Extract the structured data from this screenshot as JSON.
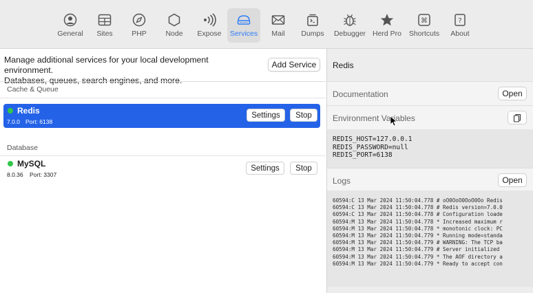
{
  "toolbar": {
    "items": [
      {
        "label": "General",
        "icon": "general-icon"
      },
      {
        "label": "Sites",
        "icon": "sites-icon"
      },
      {
        "label": "PHP",
        "icon": "php-icon"
      },
      {
        "label": "Node",
        "icon": "node-icon"
      },
      {
        "label": "Expose",
        "icon": "expose-icon"
      },
      {
        "label": "Services",
        "icon": "services-icon"
      },
      {
        "label": "Mail",
        "icon": "mail-icon"
      },
      {
        "label": "Dumps",
        "icon": "dumps-icon"
      },
      {
        "label": "Debugger",
        "icon": "debugger-icon"
      },
      {
        "label": "Herd Pro",
        "icon": "star-icon"
      },
      {
        "label": "Shortcuts",
        "icon": "command-icon"
      },
      {
        "label": "About",
        "icon": "question-icon"
      }
    ],
    "active": "Services",
    "accent": "#2e7cf6"
  },
  "left": {
    "intro_line1": "Manage additional services for your local development environment.",
    "intro_line2": "Databases, queues, search engines, and more.",
    "add_service_label": "Add Service",
    "sections": [
      {
        "title": "Cache & Queue",
        "services": [
          {
            "name": "Redis",
            "version": "7.0.0",
            "port": "Port: 6138",
            "status_color": "#31c748",
            "settings_label": "Settings",
            "stop_label": "Stop",
            "selected": true
          }
        ]
      },
      {
        "title": "Database",
        "services": [
          {
            "name": "MySQL",
            "version": "8.0.36",
            "port": "Port: 3307",
            "status_color": "#31c748",
            "settings_label": "Settings",
            "stop_label": "Stop",
            "selected": false
          }
        ]
      }
    ],
    "selection_color": "#2463e8"
  },
  "right": {
    "title": "Redis",
    "documentation_label": "Documentation",
    "documentation_button": "Open",
    "env_label": "Environment Variables",
    "env_vars": [
      "REDIS_HOST=127.0.0.1",
      "REDIS_PASSWORD=null",
      "REDIS_PORT=6138"
    ],
    "logs_label": "Logs",
    "logs_button": "Open",
    "logs": [
      "60594:C 13 Mar 2024 11:50:04.778 # oO0OoO0OoO0Oo Redis",
      "60594:C 13 Mar 2024 11:50:04.778 # Redis version=7.0.0",
      "60594:C 13 Mar 2024 11:50:04.778 # Configuration loade",
      "60594:M 13 Mar 2024 11:50:04.778 * Increased maximum r",
      "60594:M 13 Mar 2024 11:50:04.778 * monotonic clock: PC",
      "60594:M 13 Mar 2024 11:50:04.779 * Running mode=standa",
      "60594:M 13 Mar 2024 11:50:04.779 # WARNING: The TCP ba",
      "60594:M 13 Mar 2024 11:50:04.779 # Server initialized",
      "60594:M 13 Mar 2024 11:50:04.779 * The AOF directory a",
      "60594:M 13 Mar 2024 11:50:04.779 * Ready to accept con"
    ]
  }
}
